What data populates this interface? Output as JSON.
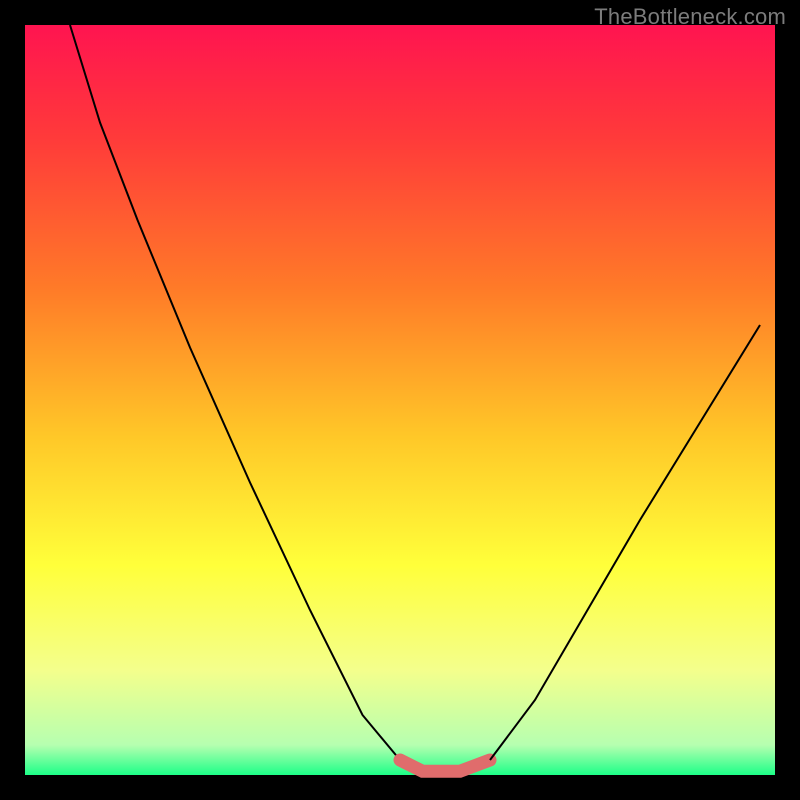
{
  "watermark": "TheBottleneck.com",
  "chart_data": {
    "type": "line",
    "title": "",
    "xlabel": "",
    "ylabel": "",
    "xlim": [
      0,
      100
    ],
    "ylim": [
      0,
      100
    ],
    "gradient_stops": [
      {
        "pct": 0,
        "color": "#ff1450"
      },
      {
        "pct": 15,
        "color": "#ff3a3a"
      },
      {
        "pct": 35,
        "color": "#ff7a28"
      },
      {
        "pct": 55,
        "color": "#ffc828"
      },
      {
        "pct": 72,
        "color": "#ffff3a"
      },
      {
        "pct": 86,
        "color": "#f4ff8c"
      },
      {
        "pct": 96,
        "color": "#b6ffb0"
      },
      {
        "pct": 100,
        "color": "#1dff88"
      }
    ],
    "series": [
      {
        "name": "left-curve",
        "stroke": "#000000",
        "stroke_width": 2,
        "x": [
          6,
          10,
          15,
          22,
          30,
          38,
          45,
          50
        ],
        "y": [
          100,
          87,
          74,
          57,
          39,
          22,
          8,
          2
        ]
      },
      {
        "name": "flat-red-segment",
        "stroke": "#e06c6c",
        "stroke_width": 13,
        "linecap": "round",
        "x": [
          50,
          53,
          58,
          62
        ],
        "y": [
          2,
          0.5,
          0.5,
          2
        ]
      },
      {
        "name": "right-curve",
        "stroke": "#000000",
        "stroke_width": 2,
        "x": [
          62,
          68,
          75,
          82,
          90,
          98
        ],
        "y": [
          2,
          10,
          22,
          34,
          47,
          60
        ]
      }
    ]
  }
}
